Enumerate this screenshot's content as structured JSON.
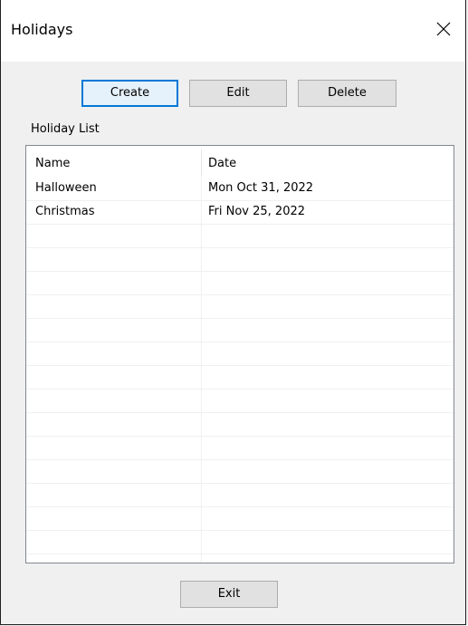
{
  "window": {
    "title": "Holidays"
  },
  "toolbar": {
    "create_label": "Create",
    "edit_label": "Edit",
    "delete_label": "Delete"
  },
  "holiday_list": {
    "label": "Holiday List",
    "columns": [
      "Name",
      "Date"
    ],
    "rows": [
      {
        "name": "Halloween",
        "date": "Mon Oct 31, 2022"
      },
      {
        "name": "Christmas",
        "date": "Fri Nov 25, 2022"
      }
    ]
  },
  "footer": {
    "exit_label": "Exit"
  }
}
